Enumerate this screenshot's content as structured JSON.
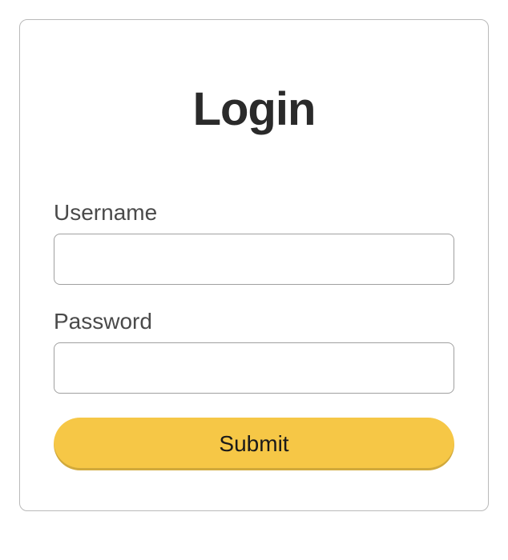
{
  "form": {
    "title": "Login",
    "username": {
      "label": "Username",
      "value": ""
    },
    "password": {
      "label": "Password",
      "value": ""
    },
    "submit_label": "Submit"
  },
  "colors": {
    "accent": "#f6c746",
    "border": "#b9b9b9",
    "text_dark": "#2a2a2a",
    "text_label": "#4a4a4a"
  }
}
